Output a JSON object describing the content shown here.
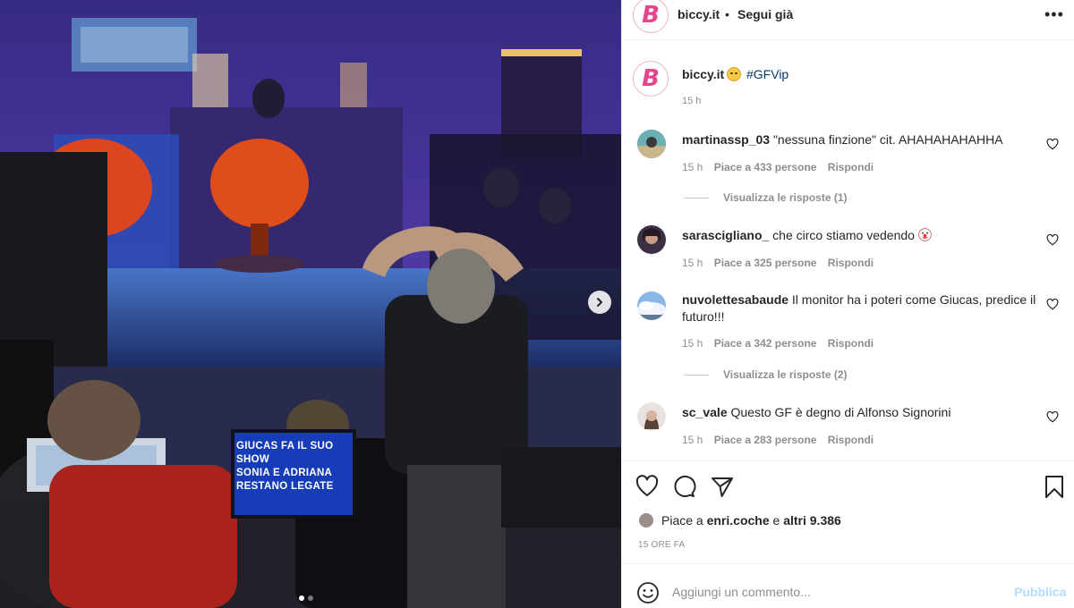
{
  "header": {
    "username": "biccy.it",
    "separator": "•",
    "follow_label": "Segui già",
    "more_label": "•••",
    "logo_letter": "B"
  },
  "caption": {
    "username": "biccy.it",
    "emoji": "grinning-face",
    "hashtag": "#GFVip",
    "time": "15 h"
  },
  "comments": [
    {
      "username": "martinassp_03",
      "text": "\"nessuna finzione\" cit. AHAHAHAHAHHA",
      "time": "15 h",
      "likes": "Piace a 433 persone",
      "reply_label": "Rispondi",
      "view_replies": "Visualizza le risposte (1)"
    },
    {
      "username": "sarascigliano_",
      "text": "che circo stiamo vedendo",
      "emoji": "clown-face",
      "time": "15 h",
      "likes": "Piace a 325 persone",
      "reply_label": "Rispondi"
    },
    {
      "username": "nuvolettesabaude",
      "text": "Il monitor ha i poteri come Giucas, predice il futuro!!!",
      "time": "15 h",
      "likes": "Piace a 342 persone",
      "reply_label": "Rispondi",
      "view_replies": "Visualizza le risposte (2)"
    },
    {
      "username": "sc_vale",
      "text": "Questo GF è degno di Alfonso Signorini",
      "time": "15 h",
      "likes": "Piace a 283 persone",
      "reply_label": "Rispondi"
    }
  ],
  "likes_summary": {
    "prefix": "Piace a ",
    "user": "enri.coche",
    "middle": " e ",
    "others": "altri 9.386"
  },
  "posted_ago": "15 ORE FA",
  "composer": {
    "placeholder": "Aggiungi un commento...",
    "publish_label": "Pubblica"
  },
  "media": {
    "monitor_text": [
      "GIUCAS FA IL SUO",
      "SHOW",
      "SONIA E ADRIANA",
      "RESTANO LEGATE"
    ],
    "carousel_index": 1,
    "carousel_count": 2
  },
  "colors": {
    "brand_pink": "#e4468e",
    "link_blue": "#00376b",
    "muted": "#8e8e8e",
    "publish_disabled": "#b2dffc"
  }
}
